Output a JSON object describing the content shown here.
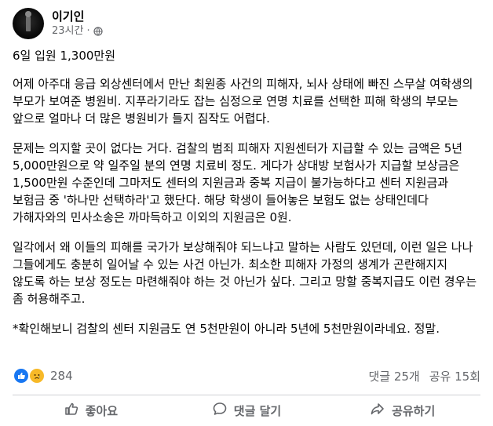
{
  "post": {
    "author": "이기인",
    "time": "23시간",
    "separator": "·",
    "privacy_icon": "globe-icon"
  },
  "content": {
    "title": "6일 입원 1,300만원",
    "paragraphs": [
      "어제 아주대 응급 외상센터에서 만난 최원종 사건의 피해자, 뇌사 상태에 빠진 스무살 여학생의 부모가 보여준 병원비. 지푸라기라도 잡는 심정으로 연명 치료를 선택한 피해 학생의 부모는 앞으로 얼마나 더 많은 병원비가 들지 짐작도 어렵다.",
      "문제는 의지할 곳이 없다는 거다. 검찰의 범죄 피해자 지원센터가 지급할 수 있는 금액은 5년 5,000만원으로 약 일주일 분의 연명 치료비 정도. 게다가 상대방 보험사가 지급할 보상금은 1,500만원 수준인데 그마저도 센터의 지원금과 중복 지급이 불가능하다고 센터 지원금과 보험금 중 '하나만 선택하라'고 했단다. 해당 학생이 들어놓은 보험도 없는 상태인데다 가해자와의 민사소송은 까마득하고 이외의 지원금은 0원.",
      "일각에서 왜 이들의 피해를 국가가 보상해줘야 되느냐고 말하는 사람도 있던데, 이런 일은 나나 그들에게도 충분히 일어날 수 있는 사건 아닌가. 최소한 피해자 가정의 생계가 곤란해지지 않도록 하는 보상 정도는 마련해줘야 하는 것 아닌가 싶다. 그리고 망할 중복지급도 이런 경우는 좀 허용해주고.",
      "*확인해보니 검찰의 센터 지원금도 연 5천만원이 아니라 5년에 5천만원이라네요. 정말."
    ]
  },
  "stats": {
    "reaction_icons": [
      "like-icon",
      "sad-icon"
    ],
    "reaction_count": "284",
    "comments": "댓글 25개",
    "shares": "공유 15회"
  },
  "actions": {
    "like": "좋아요",
    "comment": "댓글 달기",
    "share": "공유하기"
  },
  "colors": {
    "text": "#050505",
    "secondary": "#65676b",
    "like_blue": "#1877f2",
    "sad_yellow": "#f7b928",
    "divider": "#ced0d4"
  }
}
